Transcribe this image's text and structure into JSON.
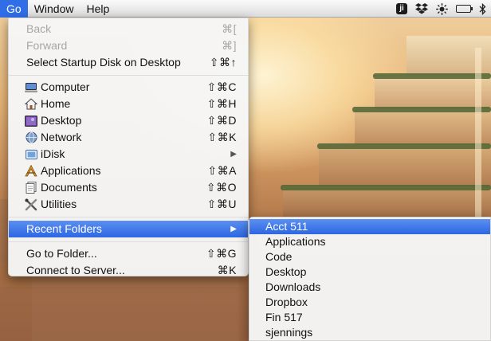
{
  "menubar": {
    "apple_icon": "apple-icon",
    "items": [
      {
        "label": "Go",
        "active": true
      },
      {
        "label": "Window",
        "active": false
      },
      {
        "label": "Help",
        "active": false
      }
    ],
    "status_icons": [
      "ji-icon",
      "dropbox-icon",
      "brightness-icon",
      "battery-icon",
      "bluetooth-icon"
    ],
    "ji_label": "ji"
  },
  "go_menu": {
    "back": {
      "label": "Back",
      "shortcut": "⌘[",
      "enabled": false
    },
    "forward": {
      "label": "Forward",
      "shortcut": "⌘]",
      "enabled": false
    },
    "startup": {
      "label": "Select Startup Disk on Desktop",
      "shortcut": "⇧⌘↑"
    },
    "places": [
      {
        "label": "Computer",
        "shortcut": "⇧⌘C",
        "icon": "computer-icon"
      },
      {
        "label": "Home",
        "shortcut": "⇧⌘H",
        "icon": "home-icon"
      },
      {
        "label": "Desktop",
        "shortcut": "⇧⌘D",
        "icon": "desktop-icon"
      },
      {
        "label": "Network",
        "shortcut": "⇧⌘K",
        "icon": "network-icon"
      },
      {
        "label": "iDisk",
        "shortcut": "",
        "icon": "idisk-icon",
        "submenu": true
      },
      {
        "label": "Applications",
        "shortcut": "⇧⌘A",
        "icon": "applications-icon"
      },
      {
        "label": "Documents",
        "shortcut": "⇧⌘O",
        "icon": "documents-icon"
      },
      {
        "label": "Utilities",
        "shortcut": "⇧⌘U",
        "icon": "utilities-icon"
      }
    ],
    "recent": {
      "label": "Recent Folders",
      "highlighted": true
    },
    "goto": {
      "label": "Go to Folder...",
      "shortcut": "⇧⌘G"
    },
    "connect": {
      "label": "Connect to Server...",
      "shortcut": "⌘K"
    }
  },
  "recent_folders": {
    "items": [
      "Acct 511",
      "Applications",
      "Code",
      "Desktop",
      "Downloads",
      "Dropbox",
      "Fin 517",
      "sjennings"
    ],
    "highlighted_index": 0
  },
  "colors": {
    "highlight": "#2f6ee6",
    "menu_bg": "#f6f6f6",
    "disabled_text": "#a6a6a6"
  }
}
